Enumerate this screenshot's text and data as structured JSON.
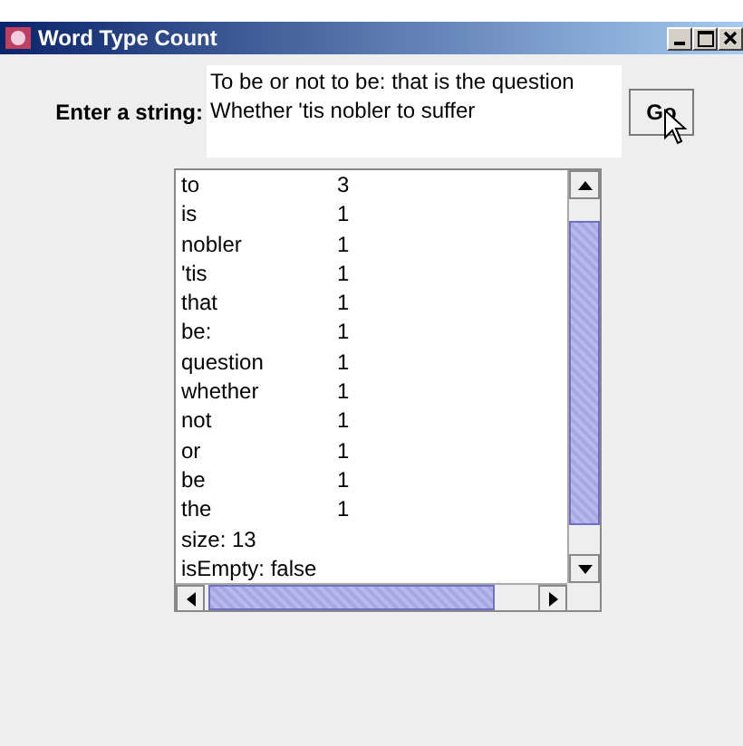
{
  "window": {
    "title": "Word Type Count"
  },
  "input": {
    "label": "Enter a string:",
    "lines": [
      "To be or not to be: that is the question",
      "Whether 'tis nobler to suffer"
    ]
  },
  "go_button": {
    "label": "Go"
  },
  "results": [
    {
      "kind": "entry",
      "word": "to",
      "count": "3"
    },
    {
      "kind": "entry",
      "word": "is",
      "count": "1"
    },
    {
      "kind": "entry",
      "word": "nobler",
      "count": "1"
    },
    {
      "kind": "entry",
      "word": "'tis",
      "count": "1"
    },
    {
      "kind": "entry",
      "word": "that",
      "count": "1"
    },
    {
      "kind": "entry",
      "word": "be:",
      "count": "1"
    },
    {
      "kind": "entry",
      "word": "question",
      "count": "1"
    },
    {
      "kind": "entry",
      "word": "whether",
      "count": "1"
    },
    {
      "kind": "entry",
      "word": "not",
      "count": "1"
    },
    {
      "kind": "entry",
      "word": "or",
      "count": "1"
    },
    {
      "kind": "entry",
      "word": "be",
      "count": "1"
    },
    {
      "kind": "entry",
      "word": "the",
      "count": "1"
    },
    {
      "kind": "line",
      "text": "size: 13"
    },
    {
      "kind": "line",
      "text": "isEmpty: false"
    }
  ]
}
